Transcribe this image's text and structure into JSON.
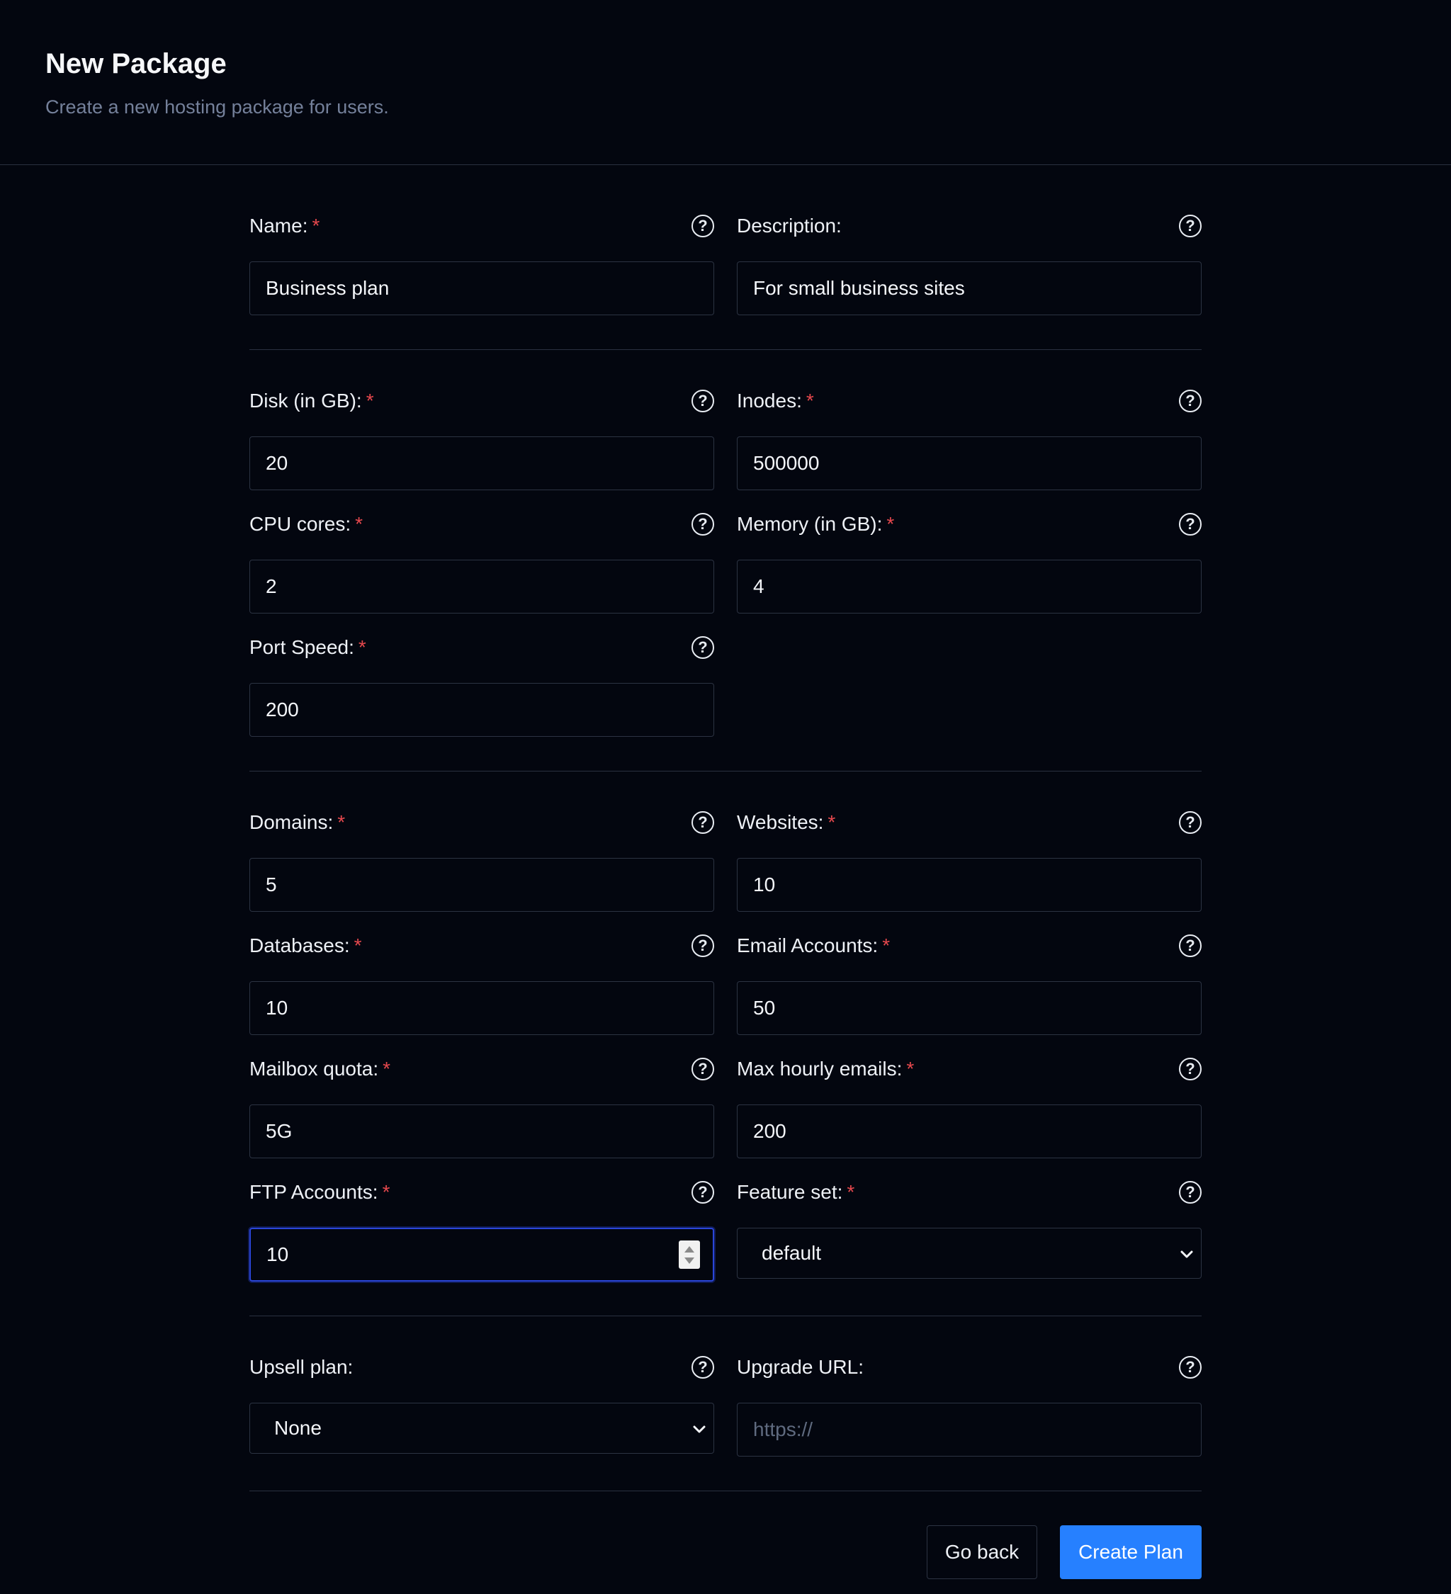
{
  "header": {
    "title": "New Package",
    "subtitle": "Create a new hosting package for users."
  },
  "help_glyph": "?",
  "required_mark": "*",
  "fields": {
    "name": {
      "label": "Name:",
      "value": "Business plan"
    },
    "description": {
      "label": "Description:",
      "value": "For small business sites"
    },
    "disk": {
      "label": "Disk (in GB):",
      "value": "20"
    },
    "inodes": {
      "label": "Inodes:",
      "value": "500000"
    },
    "cpu": {
      "label": "CPU cores:",
      "value": "2"
    },
    "memory": {
      "label": "Memory (in GB):",
      "value": "4"
    },
    "port_speed": {
      "label": "Port Speed:",
      "value": "200"
    },
    "domains": {
      "label": "Domains:",
      "value": "5"
    },
    "websites": {
      "label": "Websites:",
      "value": "10"
    },
    "databases": {
      "label": "Databases:",
      "value": "10"
    },
    "email_accounts": {
      "label": "Email Accounts:",
      "value": "50"
    },
    "mailbox_quota": {
      "label": "Mailbox quota:",
      "value": "5G"
    },
    "max_hourly_emails": {
      "label": "Max hourly emails:",
      "value": "200"
    },
    "ftp_accounts": {
      "label": "FTP Accounts:",
      "value": "10"
    },
    "feature_set": {
      "label": "Feature set:",
      "selected": "default"
    },
    "upsell_plan": {
      "label": "Upsell plan:",
      "selected": "None"
    },
    "upgrade_url": {
      "label": "Upgrade URL:",
      "value": "",
      "placeholder": "https://"
    }
  },
  "actions": {
    "back_label": "Go back",
    "create_label": "Create Plan"
  },
  "colors": {
    "background": "#03060f",
    "accent": "#2680ff",
    "required": "#e5484d",
    "focus": "#2a45d8"
  }
}
